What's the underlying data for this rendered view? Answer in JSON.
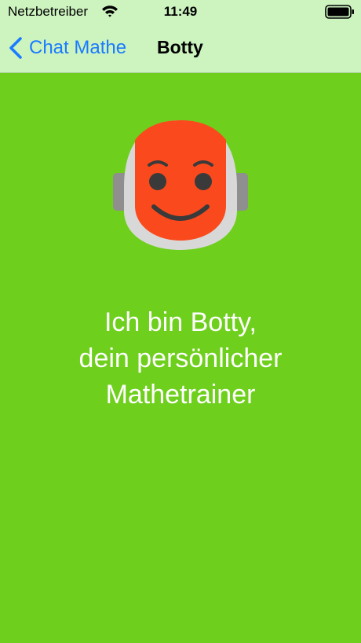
{
  "status_bar": {
    "carrier": "Netzbetreiber",
    "time": "11:49",
    "wifi_icon": "wifi-icon",
    "battery_icon": "battery-icon"
  },
  "nav": {
    "back_label": "Chat Mathe",
    "back_icon": "chevron-left-icon",
    "title": "Botty"
  },
  "robot": {
    "icon": "robot-face-icon",
    "face_color": "#fa4a1d",
    "helmet_color": "#d8d8d8",
    "ear_color": "#8f8f8f",
    "feature_color": "#3a3a3a"
  },
  "intro": {
    "lines": [
      "Ich bin Botty,",
      "dein persönlicher",
      "Mathetrainer"
    ]
  },
  "colors": {
    "background": "#6ecf1c",
    "nav_background": "#cdf3bf",
    "accent": "#1a7bff"
  }
}
